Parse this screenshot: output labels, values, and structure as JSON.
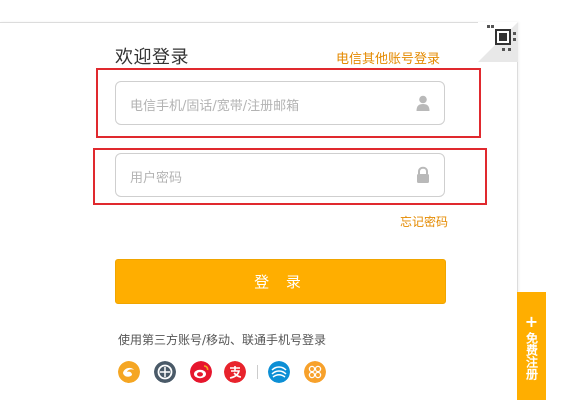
{
  "header": {
    "title": "欢迎登录",
    "other_login": "电信其他账号登录"
  },
  "form": {
    "username_placeholder": "电信手机/固话/宽带/注册邮箱",
    "password_placeholder": "用户密码",
    "forgot": "忘记密码",
    "submit": "登 录"
  },
  "third_party": {
    "title": "使用第三方账号/移动、联通手机号登录",
    "icons": [
      "tianyi-icon",
      "yuxin-icon",
      "weibo-icon",
      "alipay-icon",
      "china-mobile-icon",
      "china-unicom-icon"
    ]
  },
  "register": {
    "label": "免费注册"
  },
  "colors": {
    "accent": "#ffae00",
    "link": "#e48a00",
    "highlight": "#e0292e"
  }
}
